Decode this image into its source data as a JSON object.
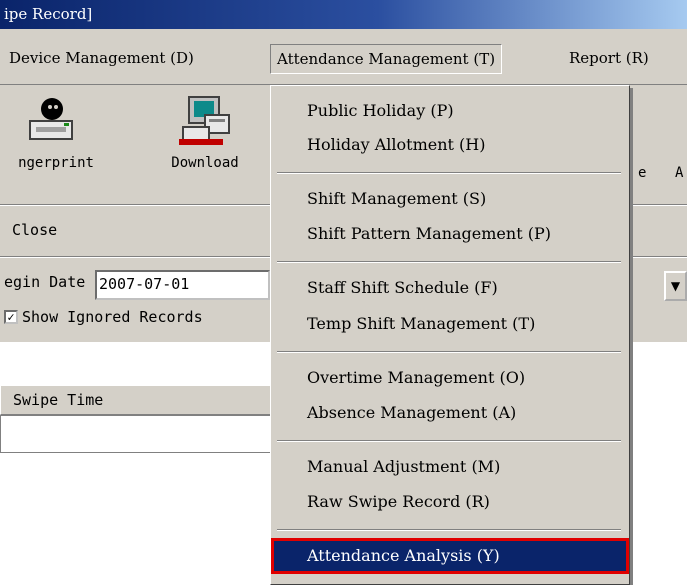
{
  "window": {
    "title": "ipe Record]"
  },
  "menubar": {
    "items": [
      {
        "label": "Device Management (D)"
      },
      {
        "label": "Attendance Management (T)"
      },
      {
        "label": "Report (R)"
      }
    ]
  },
  "toolbar": {
    "buttons": [
      {
        "label": "ngerprint",
        "icon": "fingerprint-icon"
      },
      {
        "label": "Download",
        "icon": "download-computer-icon"
      }
    ],
    "partial_labels": [
      "e",
      "A"
    ]
  },
  "actions": {
    "close_label": "Close"
  },
  "filter": {
    "begin_date_label": "egin Date",
    "begin_date_value": "2007-07-01",
    "show_ignored_label": "Show Ignored Records",
    "show_ignored_checked": true
  },
  "grid": {
    "columns": [
      "Swipe Time"
    ]
  },
  "dropdown": {
    "groups": [
      [
        "Public Holiday (P)",
        "Holiday Allotment (H)"
      ],
      [
        "Shift Management (S)",
        "Shift Pattern Management (P)"
      ],
      [
        "Staff Shift Schedule (F)",
        "Temp Shift Management (T)"
      ],
      [
        "Overtime Management (O)",
        "Absence Management (A)"
      ],
      [
        "Manual Adjustment (M)",
        "Raw Swipe Record (R)"
      ],
      [
        "Attendance Analysis (Y)"
      ]
    ],
    "selected": "Attendance Analysis (Y)"
  }
}
